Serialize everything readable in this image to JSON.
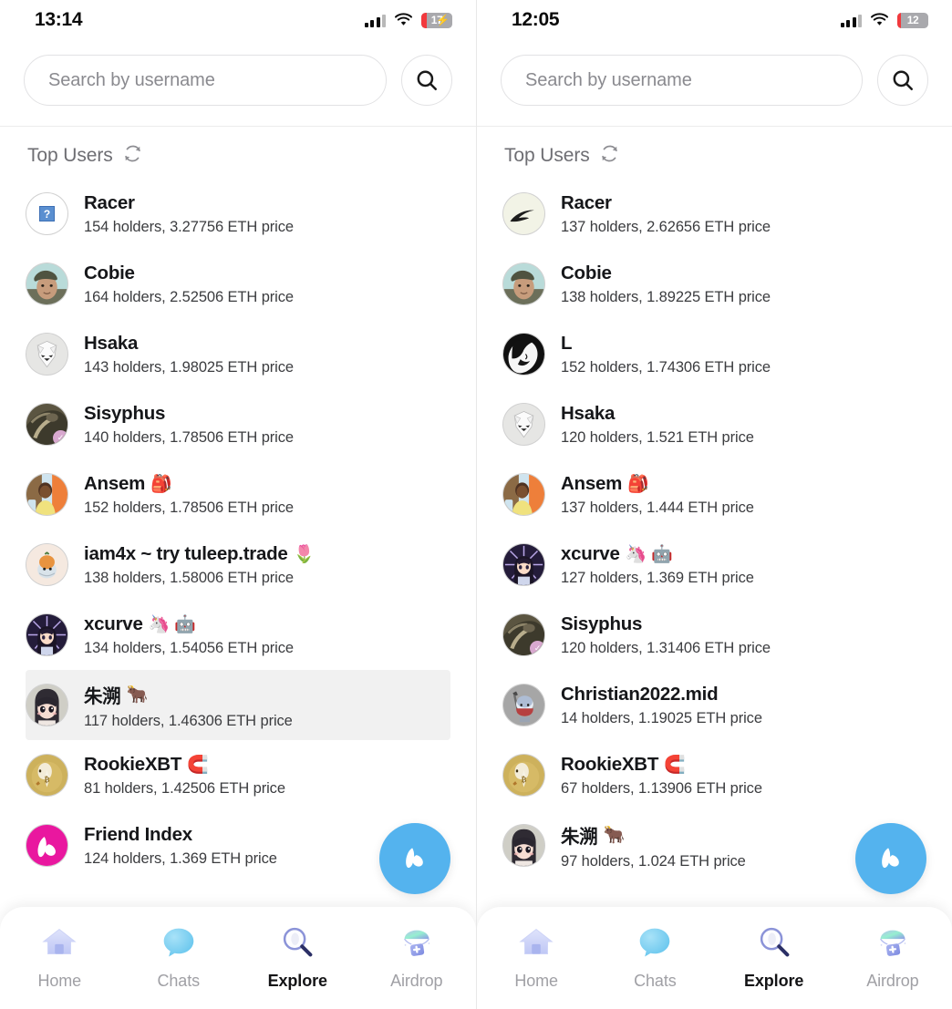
{
  "screens": [
    {
      "id": "left",
      "status": {
        "time": "13:14",
        "battery_level": "17",
        "battery_charging": true,
        "battery_fill_pct": 17
      },
      "search": {
        "placeholder": "Search by username",
        "value": "",
        "button_icon": "search-icon"
      },
      "section": {
        "title": "Top Users",
        "refresh_icon": "refresh-icon"
      },
      "users": [
        {
          "name": "Racer",
          "emoji": "",
          "meta": "154 holders, 3.27756 ETH price",
          "selected": false,
          "avatar": "racer-placeholder",
          "badge": ""
        },
        {
          "name": "Cobie",
          "emoji": "",
          "meta": "164 holders, 2.52506 ETH price",
          "selected": false,
          "avatar": "cobie",
          "badge": ""
        },
        {
          "name": "Hsaka",
          "emoji": "",
          "meta": "143 holders, 1.98025 ETH price",
          "selected": false,
          "avatar": "hsaka",
          "badge": ""
        },
        {
          "name": "Sisyphus",
          "emoji": "",
          "meta": "140 holders, 1.78506 ETH price",
          "selected": false,
          "avatar": "sisyphus",
          "badge": "✓"
        },
        {
          "name": "Ansem",
          "emoji": "🎒",
          "meta": "152 holders, 1.78506 ETH price",
          "selected": false,
          "avatar": "ansem",
          "badge": ""
        },
        {
          "name": "iam4x ~ try tuleep.trade",
          "emoji": "🌷",
          "meta": "138 holders, 1.58006 ETH price",
          "selected": false,
          "avatar": "iam4x",
          "badge": ""
        },
        {
          "name": "xcurve",
          "emoji": "🦄 🤖",
          "meta": "134 holders, 1.54056 ETH price",
          "selected": false,
          "avatar": "xcurve",
          "badge": ""
        },
        {
          "name": "朱溯",
          "emoji": "🐂",
          "meta": "117 holders, 1.46306 ETH price",
          "selected": true,
          "avatar": "zhusu",
          "badge": ""
        },
        {
          "name": "RookieXBT",
          "emoji": "🧲",
          "meta": "81 holders, 1.42506 ETH price",
          "selected": false,
          "avatar": "rookiexbt",
          "badge": ""
        },
        {
          "name": "Friend Index",
          "emoji": "",
          "meta": "124 holders, 1.369 ETH price",
          "selected": false,
          "avatar": "friendindex",
          "badge": ""
        }
      ],
      "fab": {
        "icon": "friendtech-logo-icon",
        "color": "#54b3ee"
      },
      "tabs": [
        {
          "label": "Home",
          "icon": "home-icon",
          "active": false
        },
        {
          "label": "Chats",
          "icon": "chat-bubble-icon",
          "active": false
        },
        {
          "label": "Explore",
          "icon": "magnifier-icon",
          "active": true
        },
        {
          "label": "Airdrop",
          "icon": "parachute-icon",
          "active": false
        }
      ]
    },
    {
      "id": "right",
      "status": {
        "time": "12:05",
        "battery_level": "12",
        "battery_charging": false,
        "battery_fill_pct": 12
      },
      "search": {
        "placeholder": "Search by username",
        "value": "",
        "button_icon": "search-icon"
      },
      "section": {
        "title": "Top Users",
        "refresh_icon": "refresh-icon"
      },
      "users": [
        {
          "name": "Racer",
          "emoji": "",
          "meta": "137 holders, 2.62656 ETH price",
          "selected": false,
          "avatar": "racer-feather",
          "badge": ""
        },
        {
          "name": "Cobie",
          "emoji": "",
          "meta": "138 holders, 1.89225 ETH price",
          "selected": false,
          "avatar": "cobie",
          "badge": ""
        },
        {
          "name": "L",
          "emoji": "",
          "meta": "152 holders, 1.74306 ETH price",
          "selected": false,
          "avatar": "l-manga",
          "badge": ""
        },
        {
          "name": "Hsaka",
          "emoji": "",
          "meta": "120 holders, 1.521 ETH price",
          "selected": false,
          "avatar": "hsaka",
          "badge": ""
        },
        {
          "name": "Ansem",
          "emoji": "🎒",
          "meta": "137 holders, 1.444 ETH price",
          "selected": false,
          "avatar": "ansem",
          "badge": ""
        },
        {
          "name": "xcurve",
          "emoji": "🦄 🤖",
          "meta": "127 holders, 1.369 ETH price",
          "selected": false,
          "avatar": "xcurve",
          "badge": ""
        },
        {
          "name": "Sisyphus",
          "emoji": "",
          "meta": "120 holders, 1.31406 ETH price",
          "selected": false,
          "avatar": "sisyphus",
          "badge": "✓"
        },
        {
          "name": "Christian2022.mid",
          "emoji": "",
          "meta": "14 holders, 1.19025 ETH price",
          "selected": false,
          "avatar": "christian",
          "badge": ""
        },
        {
          "name": "RookieXBT",
          "emoji": "🧲",
          "meta": "67 holders, 1.13906 ETH price",
          "selected": false,
          "avatar": "rookiexbt",
          "badge": ""
        },
        {
          "name": "朱溯",
          "emoji": "🐂",
          "meta": "97 holders, 1.024 ETH price",
          "selected": false,
          "avatar": "zhusu",
          "badge": ""
        }
      ],
      "fab": {
        "icon": "friendtech-logo-icon",
        "color": "#54b3ee"
      },
      "tabs": [
        {
          "label": "Home",
          "icon": "home-icon",
          "active": false
        },
        {
          "label": "Chats",
          "icon": "chat-bubble-icon",
          "active": false
        },
        {
          "label": "Explore",
          "icon": "magnifier-icon",
          "active": true
        },
        {
          "label": "Airdrop",
          "icon": "parachute-icon",
          "active": false
        }
      ]
    }
  ]
}
